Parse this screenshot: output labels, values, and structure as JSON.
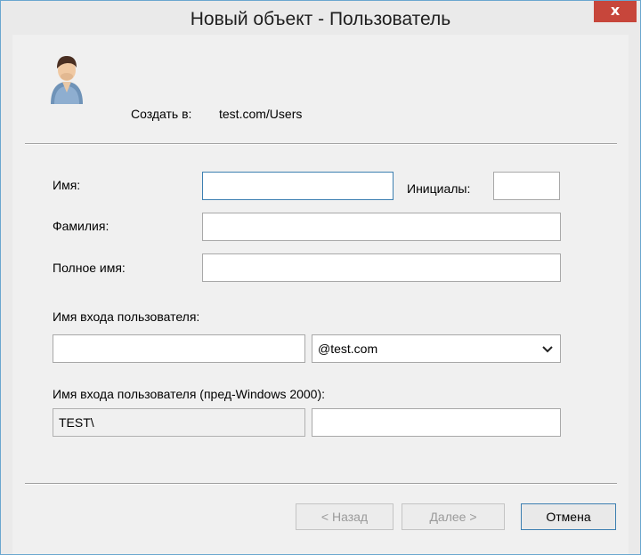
{
  "window": {
    "title": "Новый объект - Пользователь",
    "close_label": "x"
  },
  "header": {
    "create_in_label": "Создать в:",
    "create_in_value": "test.com/Users"
  },
  "form": {
    "first_name_label": "Имя:",
    "first_name_value": "",
    "initials_label": "Инициалы:",
    "initials_value": "",
    "last_name_label": "Фамилия:",
    "last_name_value": "",
    "full_name_label": "Полное имя:",
    "full_name_value": "",
    "logon_name_label": "Имя входа пользователя:",
    "logon_name_value": "",
    "upn_suffix_value": "@test.com",
    "pre2000_label": "Имя входа пользователя (пред-Windows 2000):",
    "pre2000_domain_value": "TEST\\",
    "pre2000_name_value": ""
  },
  "buttons": {
    "back_label": "< Назад",
    "next_label": "Далее >",
    "cancel_label": "Отмена"
  },
  "icons": {
    "user": "user-icon",
    "dropdown": "chevron-down-icon",
    "close": "close-icon"
  }
}
